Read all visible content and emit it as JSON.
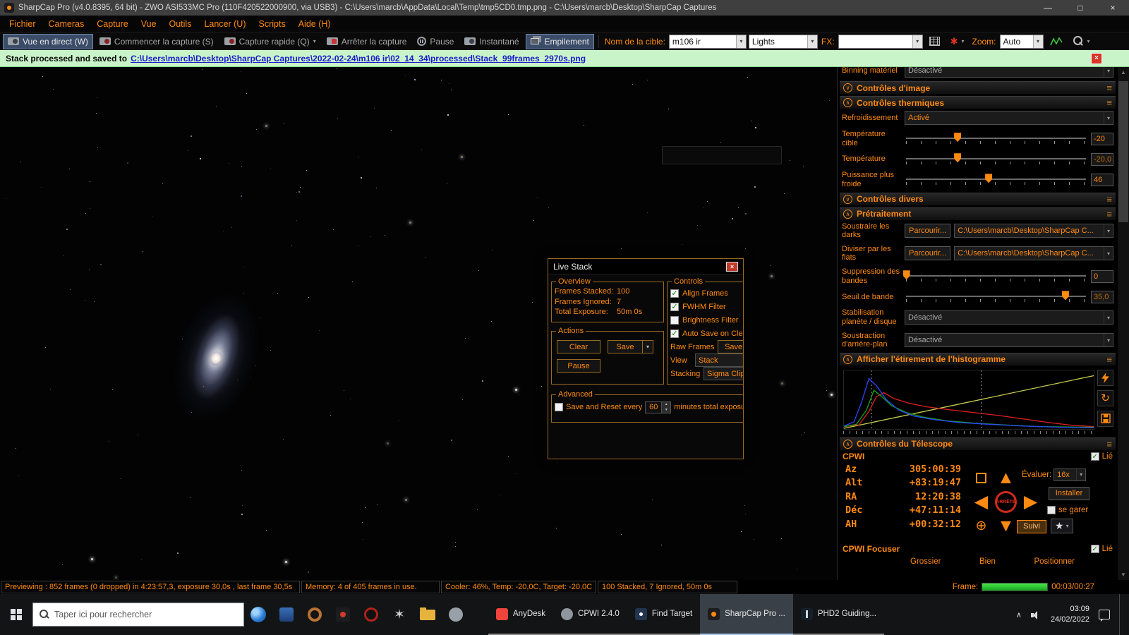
{
  "icons": {
    "caret": "▾",
    "check": "✓",
    "hamburger": "≡",
    "chevron_up": "∧",
    "chevron_down": "∨",
    "close": "×",
    "minimize": "—",
    "maximize": "□",
    "arrow_up": "▲",
    "arrow_down": "▼",
    "arrow_left": "◀",
    "arrow_right": "▶",
    "target": "⊕",
    "star": "★",
    "reset": "↻",
    "starburst": "✶",
    "asterisk": "✱"
  },
  "title_bar": {
    "title": "SharpCap Pro (v4.0.8395, 64 bit) - ZWO ASI533MC Pro (110F420522000900, via USB3) - C:\\Users\\marcb\\AppData\\Local\\Temp\\tmp5CD0.tmp.png - C:\\Users\\marcb\\Desktop\\SharpCap Captures"
  },
  "menu": {
    "items": [
      "Fichier",
      "Cameras",
      "Capture",
      "Vue",
      "Outils",
      "Lancer (U)",
      "Scripts",
      "Aide (H)"
    ]
  },
  "toolbar": {
    "live_view": "Vue en direct (W)",
    "start_capture": "Commencer la capture (S)",
    "quick_capture": "Capture rapide (Q)",
    "stop_capture": "Arrêter la capture",
    "pause": "Pause",
    "snapshot": "Instantané",
    "stack": "Empilement",
    "target_label": "Nom de la cible:",
    "target_value": "m106 ir",
    "frame_type_value": "Lights",
    "fx_label": "FX:",
    "fx_value": "",
    "zoom_label": "Zoom:",
    "zoom_value": "Auto"
  },
  "notification": {
    "prefix": "Stack processed and saved to",
    "link": "C:\\Users\\marcb\\Desktop\\SharpCap Captures\\2022-02-24\\m106 ir\\02_14_34\\processed\\Stack_99frames_2970s.png"
  },
  "live_stack": {
    "title": "Live Stack",
    "overview": {
      "legend": "Overview",
      "rows": [
        {
          "label": "Frames Stacked:",
          "value": "100"
        },
        {
          "label": "Frames Ignored:",
          "value": "7"
        },
        {
          "label": "Total Exposure:",
          "value": "50m 0s"
        }
      ]
    },
    "controls": {
      "legend": "Controls",
      "checkboxes": [
        {
          "label": "Align Frames",
          "checked": true
        },
        {
          "label": "FWHM Filter",
          "checked": true
        },
        {
          "label": "Brightness Filter",
          "checked": false
        },
        {
          "label": "Auto Save on Clea",
          "checked": true
        }
      ],
      "raw_frames_label": "Raw Frames",
      "save_stack_button": "Save St",
      "view_label": "View",
      "view_value": "Stack",
      "stacking_label": "Stacking",
      "stacking_value": "Sigma Clipp"
    },
    "actions": {
      "legend": "Actions",
      "clear": "Clear",
      "save": "Save",
      "pause": "Pause"
    },
    "advanced": {
      "legend": "Advanced",
      "checkbox_checked": false,
      "checkbox_label": "Save and Reset every",
      "interval_value": "60",
      "suffix": "minutes total exposu"
    }
  },
  "right_panel": {
    "binning": {
      "label": "Binning matériel",
      "value": "Désactivé"
    },
    "sections": {
      "image_controls": "Contrôles d'image",
      "thermal_controls": "Contrôles thermiques",
      "misc_controls": "Contrôles divers",
      "preprocessing": "Prétraitement",
      "histogram": "Afficher l'étirement de l'histogramme",
      "telescope": "Contrôles du Télescope"
    },
    "thermal": {
      "cooling_label": "Refroidissement",
      "cooling_value": "Activé",
      "target_temp_label": "Température cible",
      "target_temp_value": "-20",
      "target_temp_pct": 29,
      "temp_label": "Température",
      "temp_value": "-20,0",
      "temp_pct": 29,
      "cooler_power_label": "Puissance plus froide",
      "cooler_power_value": "46",
      "cooler_power_pct": 46
    },
    "preprocessing": {
      "browse": "Parcourir...",
      "darks_label": "Soustraire les darks",
      "darks_path": "C:\\Users\\marcb\\Desktop\\SharpCap C...",
      "flats_label": "Diviser par les flats",
      "flats_path": "C:\\Users\\marcb\\Desktop\\SharpCap C...",
      "banding_label": "Suppression des bandes",
      "banding_value": "0",
      "banding_pct": 1,
      "banding_threshold_label": "Seuil de bande",
      "banding_threshold_value": "35,0",
      "banding_threshold_pct": 88,
      "stabilization_label": "Stabilisation planète / disque",
      "stabilization_value": "Désactivé",
      "background_label": "Soustraction d'arrière-plan",
      "background_value": "Désactivé"
    },
    "histogram": {
      "guides": [
        11,
        55
      ],
      "series": [
        {
          "name": "transfer-line",
          "color": "#c8cc4e",
          "points": [
            [
              0,
              99
            ],
            [
              100,
              9
            ]
          ]
        },
        {
          "name": "red",
          "color": "#e02020",
          "points": [
            [
              0,
              96
            ],
            [
              6,
              93
            ],
            [
              10,
              70
            ],
            [
              13,
              45
            ],
            [
              16,
              38
            ],
            [
              20,
              48
            ],
            [
              26,
              56
            ],
            [
              33,
              62
            ],
            [
              42,
              67
            ],
            [
              52,
              72
            ],
            [
              62,
              77
            ],
            [
              72,
              83
            ],
            [
              82,
              89
            ],
            [
              92,
              94
            ],
            [
              100,
              96
            ]
          ]
        },
        {
          "name": "green",
          "color": "#16a316",
          "points": [
            [
              0,
              96
            ],
            [
              5,
              92
            ],
            [
              9,
              68
            ],
            [
              12,
              34
            ],
            [
              15,
              44
            ],
            [
              19,
              60
            ],
            [
              25,
              72
            ],
            [
              32,
              80
            ],
            [
              41,
              86
            ],
            [
              52,
              90
            ],
            [
              64,
              93
            ],
            [
              78,
              96
            ],
            [
              100,
              97
            ]
          ]
        },
        {
          "name": "blue",
          "color": "#2b46ff",
          "points": [
            [
              0,
              95
            ],
            [
              4,
              88
            ],
            [
              7,
              55
            ],
            [
              10,
              14
            ],
            [
              13,
              26
            ],
            [
              17,
              50
            ],
            [
              22,
              68
            ],
            [
              28,
              78
            ],
            [
              36,
              84
            ],
            [
              46,
              89
            ],
            [
              58,
              92
            ],
            [
              72,
              95
            ],
            [
              86,
              97
            ],
            [
              100,
              98
            ]
          ]
        }
      ]
    },
    "telescope": {
      "device": "CPWI",
      "linked_label": "Lié",
      "linked_checked": true,
      "coords": [
        {
          "label": "Az",
          "value": "305:00:39"
        },
        {
          "label": "Alt",
          "value": "+83:19:47"
        },
        {
          "label": "RA",
          "value": "12:20:38"
        },
        {
          "label": "Déc",
          "value": "+47:11:14"
        },
        {
          "label": "AH",
          "value": "+00:32:12"
        }
      ],
      "stop": "ARRÊTE",
      "rate_label": "Évaluer:",
      "rate_value": "16x",
      "install": "Installer",
      "park": "se garer",
      "park_checked": false,
      "track": "Suivi"
    },
    "focuser": {
      "label": "CPWI Focuser",
      "linked_label": "Lié",
      "linked_checked": true,
      "coarse": "Grossier",
      "fine": "Bien",
      "position": "Positionner"
    }
  },
  "status_bar": {
    "segments": [
      "Previewing : 852 frames (0 dropped) in 4:23:57,3, exposure 30,0s , last frame 30,5s",
      "Memory: 4 of 405 frames in use.",
      "Cooler: 46%, Temp: -20,0C, Target: -20,0C",
      "100 Stacked, 7 Ignored, 50m 0s"
    ],
    "frame_label": "Frame:",
    "frame_progress_pct": 100,
    "frame_time": "00:03/00:27"
  },
  "taskbar": {
    "search_placeholder": "Taper ici pour rechercher",
    "apps": [
      "AnyDesk",
      "CPWI 2.4.0",
      "Find Target",
      "SharpCap Pro ...",
      "PHD2 Guiding..."
    ],
    "time": "03:09",
    "date": "24/02/2022"
  }
}
